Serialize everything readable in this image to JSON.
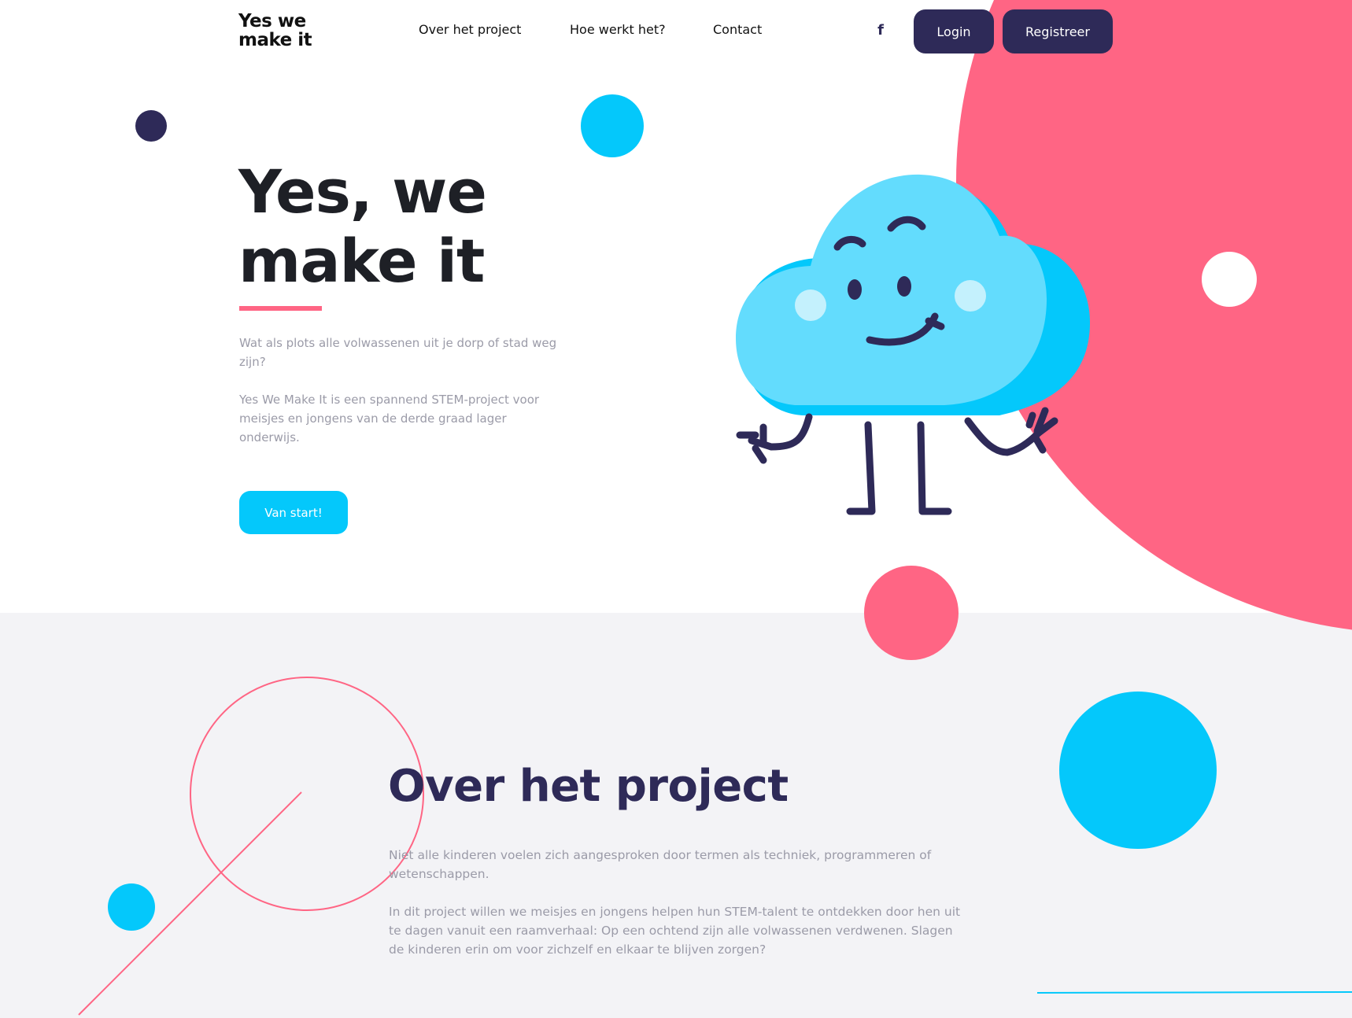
{
  "header": {
    "logo_text": "Yes we\nmake it",
    "nav": [
      {
        "label": "Over het project"
      },
      {
        "label": "Hoe werkt het?"
      },
      {
        "label": "Contact"
      }
    ],
    "facebook_icon": "facebook-icon",
    "facebook_glyph": "f",
    "login_label": "Login",
    "register_label": "Registreer"
  },
  "hero": {
    "title_line1": "Yes, we",
    "title_line2": "make it",
    "paragraph1": "Wat als plots alle volwassenen uit je dorp of stad weg zijn?",
    "paragraph2": "Yes We Make It is een spannend STEM-project voor meisjes en jongens van de derde graad lager onderwijs.",
    "cta_label": "Van start!",
    "mascot_icon": "cloud-mascot-illustration"
  },
  "about": {
    "title": "Over het project",
    "paragraph1": "Niet alle kinderen voelen zich aangesproken door termen als techniek, programmeren of wetenschappen.",
    "paragraph2": "In dit project willen we meisjes en jongens helpen hun STEM-talent te ontdekken door hen uit te dagen vanuit een raamverhaal: Op een ochtend zijn alle volwassenen verdwenen. Slagen de kinderen erin om voor zichzelf en elkaar te blijven zorgen?"
  },
  "colors": {
    "pink": "#ff6584",
    "cyan": "#04c8fb",
    "navy": "#2e2a58",
    "light_grey": "#f3f3f6",
    "text_grey": "#9b9ba8"
  }
}
